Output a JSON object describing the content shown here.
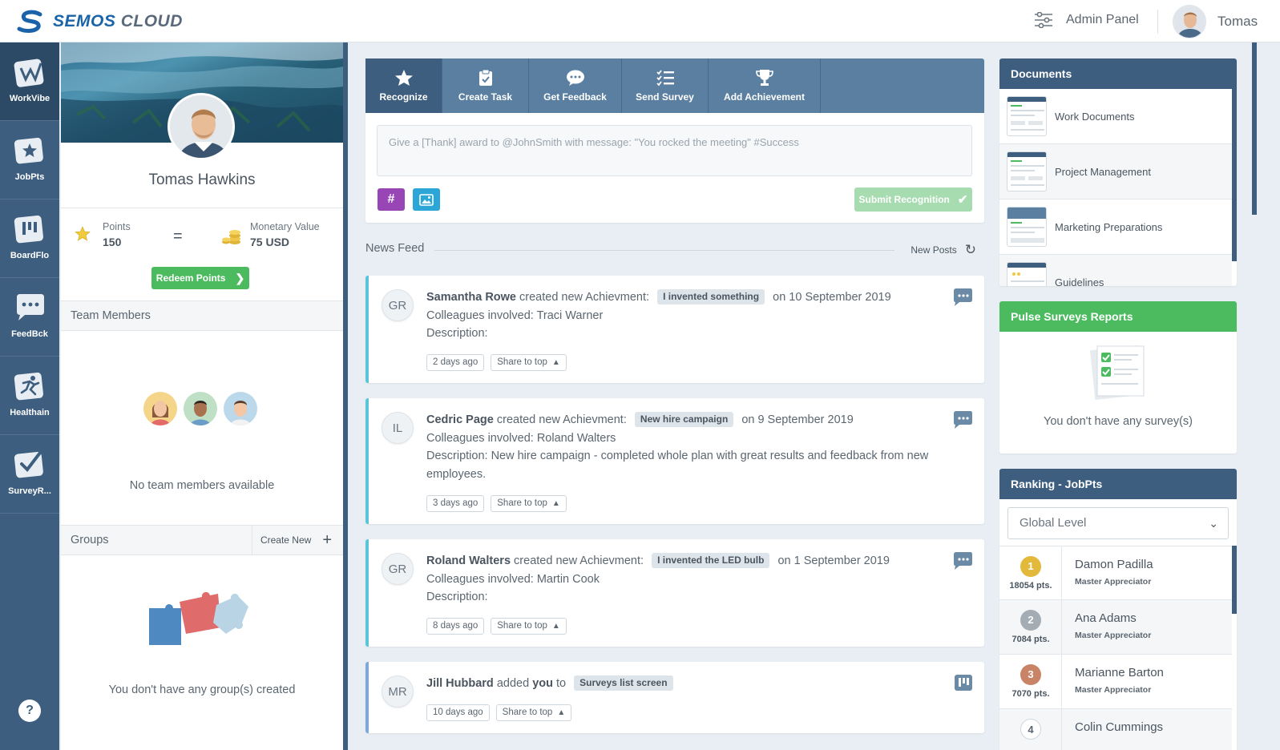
{
  "app": {
    "logo_main": "SEMOS",
    "logo_sub": "CLOUD",
    "admin_panel": "Admin Panel",
    "user_name": "Tomas"
  },
  "rail": [
    {
      "label": "WorkVibe",
      "icon": "workvibe-icon"
    },
    {
      "label": "JobPts",
      "icon": "star-folder-icon"
    },
    {
      "label": "BoardFlo",
      "icon": "board-icon"
    },
    {
      "label": "FeedBck",
      "icon": "chat-icon"
    },
    {
      "label": "Healthain",
      "icon": "runner-icon"
    },
    {
      "label": "SurveyR...",
      "icon": "check-icon"
    }
  ],
  "rail_help": "?",
  "profile": {
    "name": "Tomas Hawkins",
    "points_label": "Points",
    "points_value": "150",
    "equals": "=",
    "monetary_label": "Monetary Value",
    "monetary_value": "75 USD",
    "redeem_label": "Redeem Points",
    "team_header": "Team Members",
    "team_empty": "No team members available",
    "groups_header": "Groups",
    "create_new": "Create New",
    "groups_empty": "You don't have any group(s) created"
  },
  "composer": {
    "tabs": [
      {
        "label": "Recognize",
        "icon": "star-icon"
      },
      {
        "label": "Create Task",
        "icon": "clipboard-icon"
      },
      {
        "label": "Get Feedback",
        "icon": "speech-bubble-icon"
      },
      {
        "label": "Send Survey",
        "icon": "checklist-icon"
      },
      {
        "label": "Add Achievement",
        "icon": "trophy-icon"
      }
    ],
    "placeholder": "Give a [Thank] award to @JohnSmith with message: \"You rocked the meeting\" #Success",
    "hash_button": "#",
    "submit_label": "Submit Recognition"
  },
  "feed": {
    "title": "News Feed",
    "new_posts": "New Posts",
    "share_label": "Share to top",
    "posts": [
      {
        "initials": "GR",
        "author": "Samantha Rowe",
        "action": "created new Achievment:",
        "tag": "I invented something",
        "date": "on 10 September 2019",
        "colleagues": "Colleagues involved: Traci Warner",
        "description": "Description:",
        "time": "2 days ago"
      },
      {
        "initials": "IL",
        "author": "Cedric Page",
        "action": "created new Achievment:",
        "tag": "New hire campaign",
        "date": "on 9 September 2019",
        "colleagues": "Colleagues involved: Roland Walters",
        "description": "Description: New hire campaign - completed whole plan with great results and feedback from new employees.",
        "time": "3 days ago"
      },
      {
        "initials": "GR",
        "author": "Roland Walters",
        "action": "created new Achievment:",
        "tag": "I invented the LED bulb",
        "date": "on 1 September 2019",
        "colleagues": "Colleagues involved: Martin Cook",
        "description": "Description:",
        "time": "8 days ago"
      },
      {
        "initials": "MR",
        "author": "Jill Hubbard",
        "action_pre": "added",
        "action_you": "you",
        "action_post": "to",
        "tag": "Surveys list screen",
        "time": "10 days ago"
      }
    ]
  },
  "documents": {
    "title": "Documents",
    "items": [
      "Work Documents",
      "Project Management",
      "Marketing Preparations",
      "Guidelines"
    ]
  },
  "pulse": {
    "title": "Pulse Surveys Reports",
    "empty": "You don't have any survey(s)"
  },
  "ranking": {
    "title": "Ranking - JobPts",
    "level": "Global Level",
    "rows": [
      {
        "rank": "1",
        "points": "18054 pts.",
        "name": "Damon Padilla",
        "title": "Master Appreciator",
        "color": "#e2b93b"
      },
      {
        "rank": "2",
        "points": "7084 pts.",
        "name": "Ana Adams",
        "title": "Master Appreciator",
        "color": "#a5adb4"
      },
      {
        "rank": "3",
        "points": "7070 pts.",
        "name": "Marianne Barton",
        "title": "Master Appreciator",
        "color": "#c98467"
      },
      {
        "rank": "4",
        "points": "",
        "name": "Colin Cummings",
        "title": "",
        "color": "#ffffff"
      }
    ]
  },
  "colors": {
    "primary": "#3d5e7e",
    "tab_bar": "#5a7fa0",
    "green": "#4cbb5f",
    "accent_teal": "#5bc5d8"
  }
}
